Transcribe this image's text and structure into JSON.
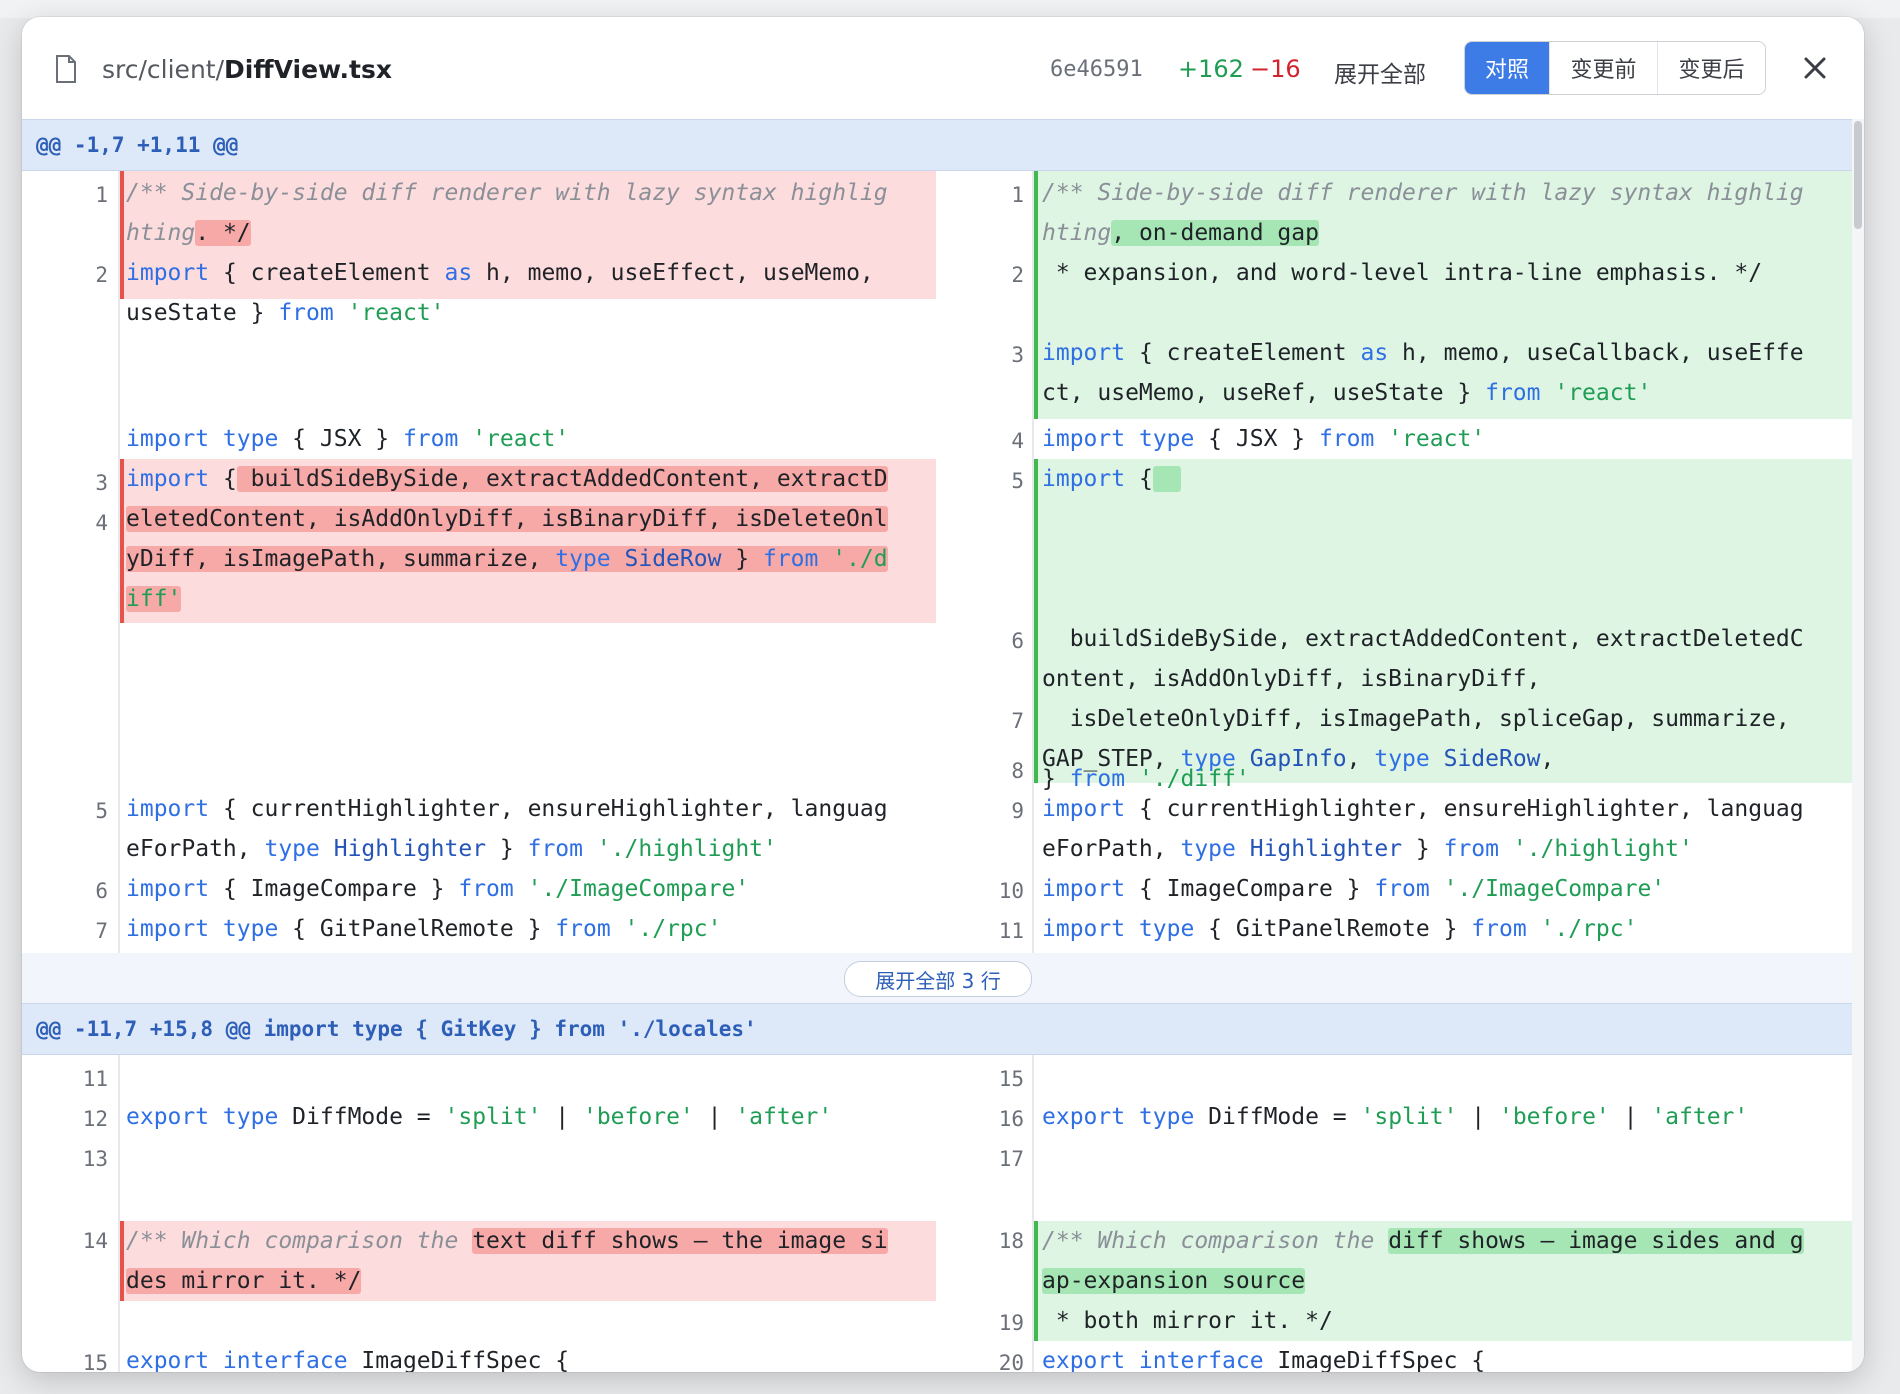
{
  "header": {
    "path_prefix": "src/client/",
    "file_name": "DiffView.tsx",
    "sha": "6e46591",
    "additions": "+162",
    "deletions": "−16",
    "expand_all": "展开全部",
    "modes": [
      "对照",
      "变更前",
      "变更后"
    ],
    "active_mode": "对照"
  },
  "icons": {
    "file": "file-icon",
    "close": "close-icon"
  },
  "colors": {
    "accent": "#3d7be6",
    "added": "#1f9d55",
    "deleted": "#d1242f"
  },
  "hunks": [
    {
      "header": "@@ -1,7 +1,11 @@"
    },
    {
      "header": "@@ -11,7 +15,8 @@ import type { GitKey } from './locales'"
    }
  ],
  "expander": {
    "label": "展开全部 3 行"
  },
  "left_lines": {
    "l1": "1",
    "l2": "2",
    "l3": "3",
    "l4": "4",
    "l5": "5",
    "l6": "6",
    "l7": "7",
    "l11": "11",
    "l12": "12",
    "l13": "13",
    "l14": "14",
    "l15": "15"
  },
  "right_lines": {
    "r1": "1",
    "r2": "2",
    "r3": "3",
    "r4": "4",
    "r5": "5",
    "r6": "6",
    "r7": "7",
    "r8": "8",
    "r9": "9",
    "r10": "10",
    "r11": "11",
    "r15": "15",
    "r16": "16",
    "r17": "17",
    "r18": "18",
    "r19": "19",
    "r20": "20"
  },
  "code": {
    "L1a": "/** Side-by-side diff renderer with lazy syntax highlig",
    "L1b": "hting",
    "L1c": ". */",
    "L2a": "import",
    "L2b": " { createElement ",
    "L2c": "as",
    "L2d": " h, memo, useEffect, useMemo,",
    "L2e": "useState } ",
    "L2f": "from",
    "L2g": "'react'",
    "L3a": "import type",
    "L3b": " { JSX } ",
    "L3c": "from",
    "L3d": "'react'",
    "L4a": "import",
    "L4b": " {",
    "L4c": " buildSideBySide, extractAddedContent, extractD",
    "L4d": "eletedContent, isAddOnlyDiff, isBinaryDiff, isDeleteOnl",
    "L4e": "yDiff, isImagePath, summarize, ",
    "L4f": "type",
    "L4g": " SideRow",
    "L4h": " } ",
    "L4i": "from",
    "L4j": " './d",
    "L4k": "iff'",
    "L5a": "import",
    "L5b": " { currentHighlighter, ensureHighlighter, languag",
    "L5c": "eForPath, ",
    "L5d": "type",
    "L5e": " Highlighter",
    "L5f": " } ",
    "L5g": "from",
    "L5h": "'./highlight'",
    "L6a": "import",
    "L6b": " { ImageCompare } ",
    "L6c": "from",
    "L6d": "'./ImageCompare'",
    "L7a": "import type",
    "L7b": " { GitPanelRemote } ",
    "L7c": "from",
    "L7d": "'./rpc'",
    "R1a": "/** Side-by-side diff renderer with lazy syntax highlig",
    "R1b": "hting",
    "R1c": ", on-demand gap",
    "R2": " * expansion, and word-level intra-line emphasis. */",
    "R3a": "import",
    "R3b": " { createElement ",
    "R3c": "as",
    "R3d": " h, memo, useCallback, useEffe",
    "R3e": "ct, useMemo, useRef, useState } ",
    "R3f": "from",
    "R3g": "'react'",
    "R4a": "import type",
    "R4b": " { JSX } ",
    "R4c": "from",
    "R4d": "'react'",
    "R5a": "import",
    "R5b": " {",
    "R6a": "  buildSideBySide, extractAddedContent, extractDeletedC",
    "R6b": "ontent, isAddOnlyDiff, isBinaryDiff,",
    "R7a": "  isDeleteOnlyDiff, isImagePath, spliceGap, summarize,",
    "R7b": "GAP_STEP, ",
    "R7c": "type",
    "R7d": " GapInfo",
    "R7e": ", ",
    "R7f": "type",
    "R7g": " SideRow",
    "R7h": ",",
    "R8a": "} ",
    "R8b": "from",
    "R8c": "'./diff'",
    "R9a": "import",
    "R9b": " { currentHighlighter, ensureHighlighter, languag",
    "R9c": "eForPath, ",
    "R9d": "type",
    "R9e": " Highlighter",
    "R9f": " } ",
    "R9g": "from",
    "R9h": "'./highlight'",
    "R10a": "import",
    "R10b": " { ImageCompare } ",
    "R10c": "from",
    "R10d": "'./ImageCompare'",
    "R11a": "import type",
    "R11b": " { GitPanelRemote } ",
    "R11c": "from",
    "R11d": "'./rpc'",
    "L12a": "export type",
    "L12b": " DiffMode = ",
    "L12c": "'split'",
    "L12d": " | ",
    "L12e": "'before'",
    "L12f": " | ",
    "L12g": "'after'",
    "L14a": "/** Which comparison the ",
    "L14b": "text diff shows — the image si",
    "L14c": "des mirror it. */",
    "L15a": "export interface",
    "L15b": " ImageDiffSpec {",
    "R16a": "export type",
    "R16b": " DiffMode = ",
    "R16c": "'split'",
    "R16d": " | ",
    "R16e": "'before'",
    "R16f": " | ",
    "R16g": "'after'",
    "R18a": "/** Which comparison the ",
    "R18b": "diff shows — image sides and g",
    "R18c": "ap-expansion source",
    "R19": " * both mirror it. */",
    "R20a": "export interface",
    "R20b": " ImageDiffSpec {"
  }
}
